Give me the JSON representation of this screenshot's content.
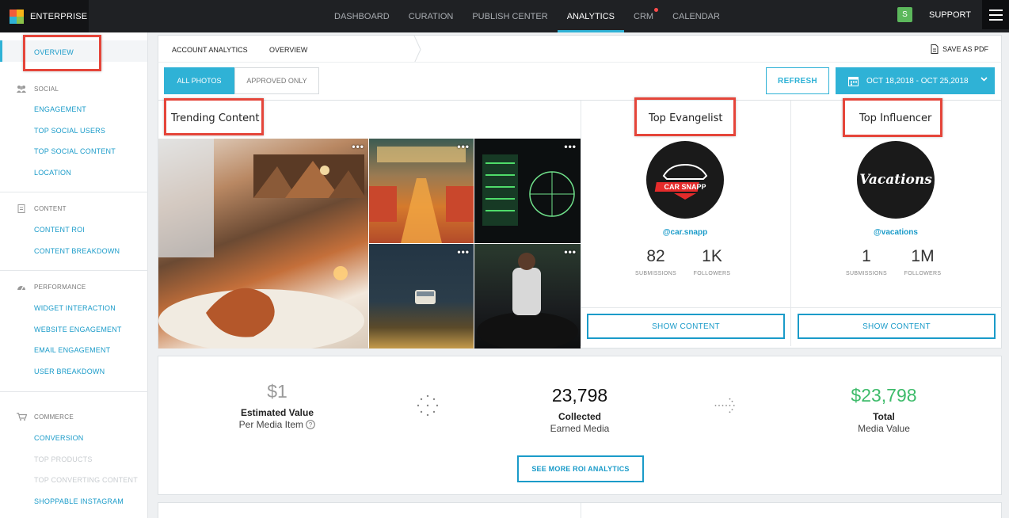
{
  "brand": {
    "name": "ENTERPRISE",
    "logo_colors": [
      "#f25c3b",
      "#f7b418",
      "#2fb2d6",
      "#8bc34a"
    ]
  },
  "nav": {
    "items": [
      "DASHBOARD",
      "CURATION",
      "PUBLISH CENTER",
      "ANALYTICS",
      "CRM",
      "CALENDAR"
    ],
    "active": "ANALYTICS",
    "shop_badge": "S",
    "support": "SUPPORT"
  },
  "sidebar": {
    "overview": "OVERVIEW",
    "social": {
      "heading": "SOCIAL",
      "items": [
        "ENGAGEMENT",
        "TOP SOCIAL USERS",
        "TOP SOCIAL CONTENT",
        "LOCATION"
      ]
    },
    "content": {
      "heading": "CONTENT",
      "items": [
        "CONTENT ROI",
        "CONTENT BREAKDOWN"
      ]
    },
    "performance": {
      "heading": "PERFORMANCE",
      "items": [
        "WIDGET INTERACTION",
        "WEBSITE ENGAGEMENT",
        "EMAIL ENGAGEMENT",
        "USER BREAKDOWN"
      ]
    },
    "commerce": {
      "heading": "COMMERCE",
      "items": [
        "CONVERSION",
        "TOP PRODUCTS",
        "TOP CONVERTING CONTENT",
        "SHOPPABLE INSTAGRAM"
      ]
    }
  },
  "breadcrumb": {
    "first": "ACCOUNT ANALYTICS",
    "second": "OVERVIEW"
  },
  "save_pdf": "SAVE AS PDF",
  "filters": {
    "all_photos": "ALL PHOTOS",
    "approved_only": "APPROVED ONLY",
    "refresh": "REFRESH",
    "date_range": "OCT 18,2018 - OCT 25,2018"
  },
  "trending": {
    "title": "Trending Content",
    "more": "•••"
  },
  "evangelist": {
    "title": "Top Evangelist",
    "avatar_text": "CAR SNAPP",
    "handle": "@car.snapp",
    "submissions": "82",
    "submissions_label": "SUBMISSIONS",
    "followers": "1K",
    "followers_label": "FOLLOWERS",
    "button": "SHOW CONTENT"
  },
  "influencer": {
    "title": "Top Influencer",
    "avatar_text": "Vacations",
    "handle": "@vacations",
    "submissions": "1",
    "submissions_label": "SUBMISSIONS",
    "followers": "1M",
    "followers_label": "FOLLOWERS",
    "button": "SHOW CONTENT"
  },
  "roi": {
    "estimated_value": "$1",
    "estimated_label": "Estimated Value",
    "estimated_sub": "Per Media Item",
    "collected": "23,798",
    "collected_label": "Collected",
    "collected_sub": "Earned Media",
    "total": "$23,798",
    "total_label": "Total",
    "total_sub": "Media Value",
    "button": "SEE MORE ROI ANALYTICS",
    "accent": "#3dbb6a"
  }
}
